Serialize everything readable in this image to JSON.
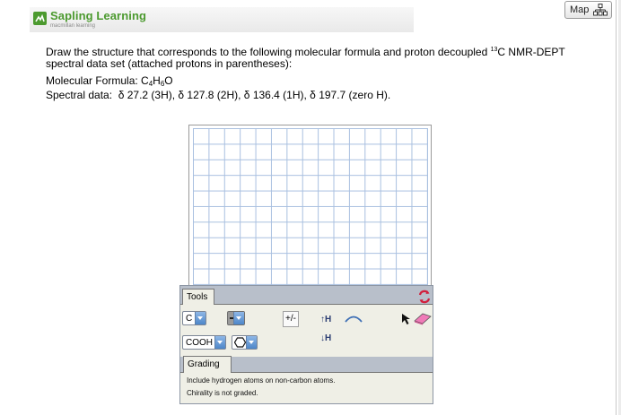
{
  "brand": {
    "name": "Sapling Learning",
    "subtitle": "macmillan learning",
    "color": "#4c9a2f"
  },
  "map_button": {
    "label": "Map",
    "icon": "sitemap-icon"
  },
  "question": {
    "text_part1": "Draw the structure that corresponds to the following molecular formula and proton decoupled ",
    "isotope_mass": "13",
    "text_part2": "C NMR-DEPT spectral data set (attached protons in parentheses):",
    "formula_label": "Molecular Formula:",
    "formula": {
      "c": "C",
      "c_sub": "4",
      "h": "H",
      "h_sub": "6",
      "o": "O"
    },
    "spectral_label": "Spectral data:",
    "spectral_values": "δ 27.2 (3H), δ 127.8 (2H), δ 136.4 (1H), δ 197.7 (zero H)."
  },
  "editor": {
    "tools_tab": "Tools",
    "atom_select": "C",
    "bond_select_icon": "single-bond-icon",
    "charge_button": "+/-",
    "add_h_label": "↑H",
    "remove_h_label": "↓H",
    "arc_icon": "curved-arrow-icon",
    "select_icon": "arrow-pointer-icon",
    "eraser_icon": "eraser-icon",
    "group_select": "COOH",
    "ring_select_icon": "hexagon-icon",
    "refresh_icon": "refresh-icon",
    "grading_tab": "Grading",
    "grading_lines": [
      "Include hydrogen atoms on non-carbon atoms.",
      "Chirality is not graded."
    ]
  }
}
